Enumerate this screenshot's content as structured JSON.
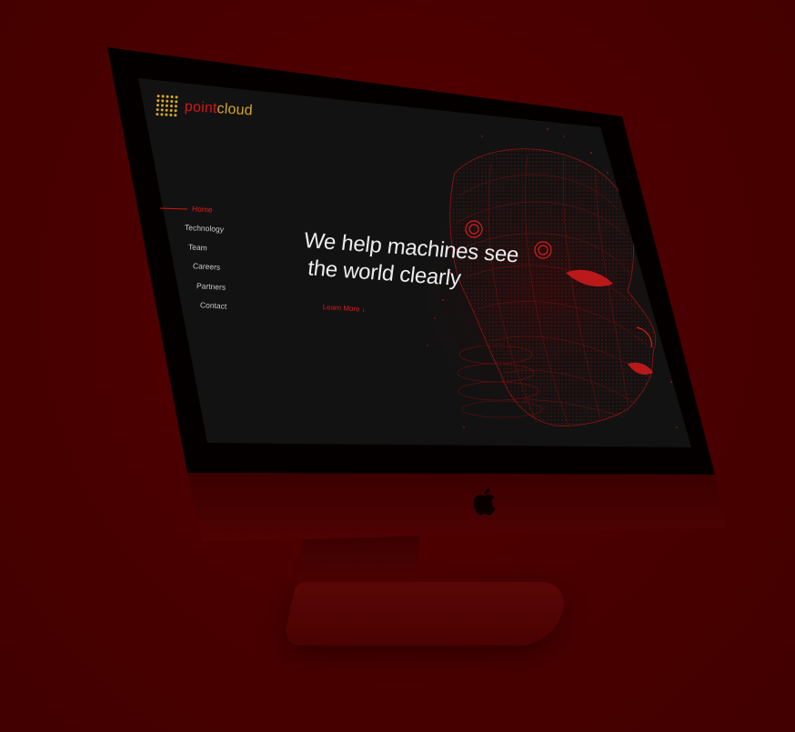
{
  "brand": {
    "logo_part1": "point",
    "logo_part2": "cloud",
    "logo_color": "#d6a629",
    "accent_color": "#d41616"
  },
  "nav": {
    "items": [
      {
        "label": "Home",
        "active": true
      },
      {
        "label": "Technology",
        "active": false
      },
      {
        "label": "Team",
        "active": false
      },
      {
        "label": "Careers",
        "active": false
      },
      {
        "label": "Partners",
        "active": false
      },
      {
        "label": "Contact",
        "active": false
      }
    ]
  },
  "hero": {
    "headline_line1": "We help machines see",
    "headline_line2": "the world clearly",
    "cta_label": "Learn More ↓"
  },
  "device": {
    "logo_icon": "apple-logo-icon"
  },
  "colors": {
    "background": "#4a0000",
    "screen": "#111111",
    "text": "#ececec"
  }
}
